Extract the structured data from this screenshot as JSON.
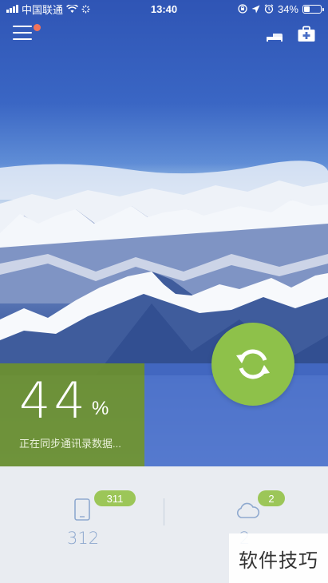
{
  "status_bar": {
    "carrier": "中国联通",
    "time": "13:40",
    "battery_percent": "34%",
    "battery_level": 0.34,
    "icons": [
      "signal-icon",
      "wifi-icon",
      "loading-icon",
      "orientation-lock-icon",
      "location-icon",
      "alarm-icon",
      "battery-icon"
    ]
  },
  "top_bar": {
    "icons": [
      "menu-icon",
      "bed-icon",
      "toolbox-icon"
    ],
    "notification_color": "#f2735a"
  },
  "progress": {
    "value": "44",
    "unit": "%",
    "status_text": "正在同步通讯录数据..."
  },
  "sync_button": {
    "icon": "sync-icon",
    "color": "#8ec14a"
  },
  "stats": {
    "local": {
      "icon": "phone-icon",
      "badge": "311",
      "count": "312"
    },
    "cloud": {
      "icon": "cloud-icon",
      "badge": "2",
      "count": "2"
    }
  },
  "watermark": {
    "text": "软件技巧"
  }
}
